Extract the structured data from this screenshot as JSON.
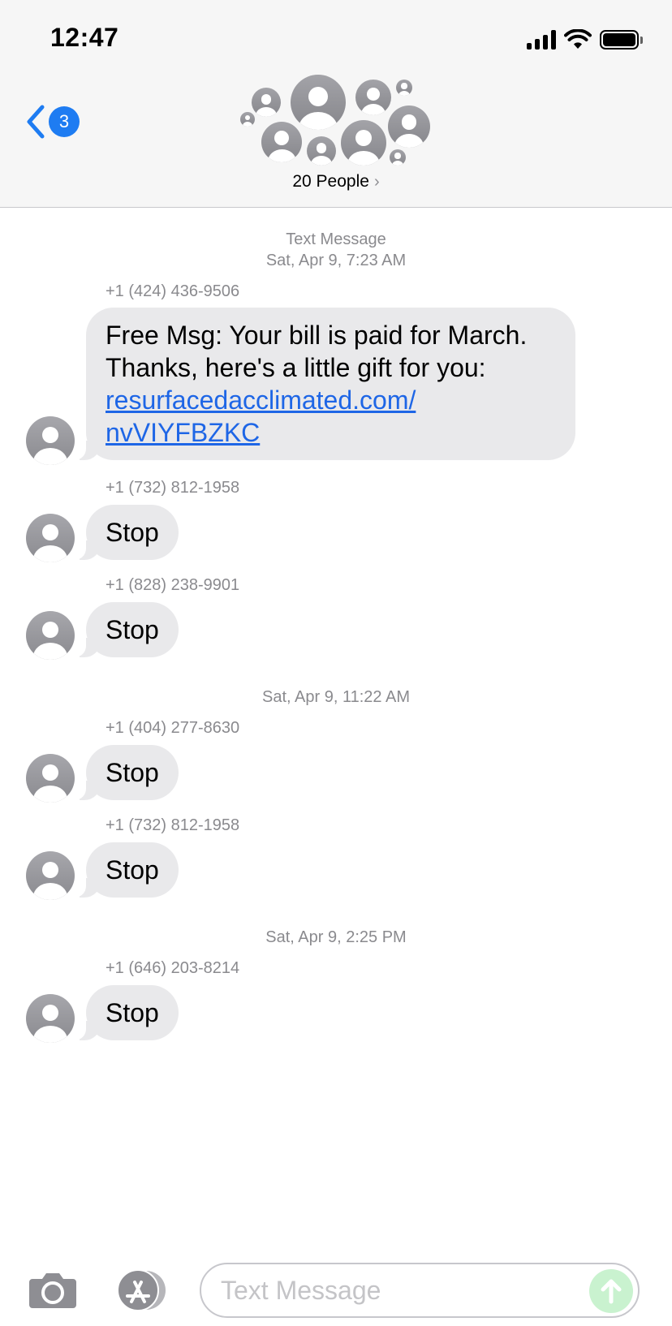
{
  "status_bar": {
    "time": "12:47"
  },
  "nav": {
    "unread_count": "3"
  },
  "group": {
    "label": "20 People"
  },
  "thread": {
    "blocks": [
      {
        "label": "Text Message",
        "timestamp": "Sat, Apr 9, 7:23 AM"
      },
      {
        "timestamp": "Sat, Apr 9, 11:22 AM"
      },
      {
        "timestamp": "Sat, Apr 9, 2:25 PM"
      }
    ],
    "messages": [
      {
        "sender": "+1 (424) 436-9506",
        "line1": "Free Msg: Your bill is paid for March.",
        "line2": "Thanks, here's a little gift for you:",
        "link1": "resurfacedacclimated.com/",
        "link2": "nvVIYFBZKC"
      },
      {
        "sender": "+1 (732) 812-1958",
        "text": "Stop"
      },
      {
        "sender": "+1 (828) 238-9901",
        "text": "Stop"
      },
      {
        "sender": "+1 (404) 277-8630",
        "text": "Stop"
      },
      {
        "sender": "+1 (732) 812-1958",
        "text": "Stop"
      },
      {
        "sender": "+1 (646) 203-8214",
        "text": "Stop"
      }
    ]
  },
  "composer": {
    "placeholder": "Text Message"
  },
  "colors": {
    "accent": "#1e7cf2",
    "bubble": "#e9e9eb",
    "link": "#1e66e6",
    "send": "#c9f2cf"
  }
}
